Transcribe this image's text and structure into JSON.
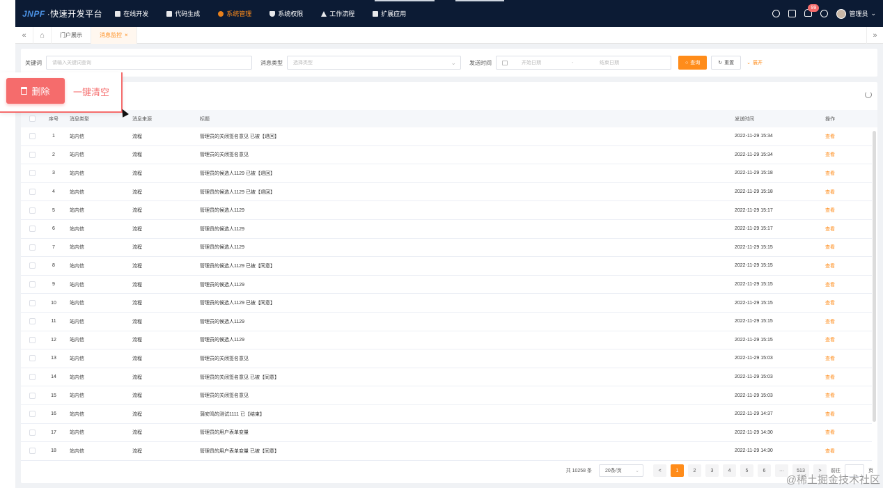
{
  "app": {
    "logo_brand": "JNPF",
    "logo_name": "·快速开发平台",
    "nav": [
      {
        "label": "在线开发",
        "icon": "monitor-icon",
        "active": false
      },
      {
        "label": "代码生成",
        "icon": "code-icon",
        "active": false
      },
      {
        "label": "系统管理",
        "icon": "gear-icon",
        "active": true
      },
      {
        "label": "系统权限",
        "icon": "shield-icon",
        "active": false
      },
      {
        "label": "工作流程",
        "icon": "workflow-icon",
        "active": false
      },
      {
        "label": "扩展应用",
        "icon": "apps-icon",
        "active": false
      }
    ],
    "notification_count": "99",
    "user_label": "管理员",
    "accent_color": "#ff8c1a",
    "danger_color": "#f56c6c"
  },
  "tabs": [
    {
      "label": "门户展示",
      "active": false
    },
    {
      "label": "消息监控",
      "active": true
    }
  ],
  "search": {
    "keyword_label": "关键词",
    "keyword_placeholder": "请输入关键词查询",
    "type_label": "消息类型",
    "type_placeholder": "选择类型",
    "time_label": "发送时间",
    "start_placeholder": "开始日期",
    "range_sep": "-",
    "end_placeholder": "结束日期",
    "query_label": "查询",
    "reset_label": "重置",
    "expand_label": "展开"
  },
  "callout": {
    "delete_label": "删除",
    "clear_label": "一键清空"
  },
  "table": {
    "headers": {
      "index": "序号",
      "type": "消息类型",
      "source": "消息来源",
      "title": "标题",
      "time": "发送时间",
      "action": "操作"
    },
    "rows": [
      {
        "index": "1",
        "type": "站内信",
        "source": "流程",
        "title": "管理员的关闭签名意见 已被【退回】",
        "time": "2022-11-29 15:34",
        "action": "查看"
      },
      {
        "index": "2",
        "type": "站内信",
        "source": "流程",
        "title": "管理员的关闭签名意见",
        "time": "2022-11-29 15:34",
        "action": "查看"
      },
      {
        "index": "3",
        "type": "站内信",
        "source": "流程",
        "title": "管理员的候选人1129 已被【退回】",
        "time": "2022-11-29 15:18",
        "action": "查看"
      },
      {
        "index": "4",
        "type": "站内信",
        "source": "流程",
        "title": "管理员的候选人1129 已被【退回】",
        "time": "2022-11-29 15:18",
        "action": "查看"
      },
      {
        "index": "5",
        "type": "站内信",
        "source": "流程",
        "title": "管理员的候选人1129",
        "time": "2022-11-29 15:17",
        "action": "查看"
      },
      {
        "index": "6",
        "type": "站内信",
        "source": "流程",
        "title": "管理员的候选人1129",
        "time": "2022-11-29 15:17",
        "action": "查看"
      },
      {
        "index": "7",
        "type": "站内信",
        "source": "流程",
        "title": "管理员的候选人1129",
        "time": "2022-11-29 15:15",
        "action": "查看"
      },
      {
        "index": "8",
        "type": "站内信",
        "source": "流程",
        "title": "管理员的候选人1129 已被【同意】",
        "time": "2022-11-29 15:15",
        "action": "查看"
      },
      {
        "index": "9",
        "type": "站内信",
        "source": "流程",
        "title": "管理员的候选人1129",
        "time": "2022-11-29 15:15",
        "action": "查看"
      },
      {
        "index": "10",
        "type": "站内信",
        "source": "流程",
        "title": "管理员的候选人1129 已被【同意】",
        "time": "2022-11-29 15:15",
        "action": "查看"
      },
      {
        "index": "11",
        "type": "站内信",
        "source": "流程",
        "title": "管理员的候选人1129",
        "time": "2022-11-29 15:15",
        "action": "查看"
      },
      {
        "index": "12",
        "type": "站内信",
        "source": "流程",
        "title": "管理员的候选人1129",
        "time": "2022-11-29 15:15",
        "action": "查看"
      },
      {
        "index": "13",
        "type": "站内信",
        "source": "流程",
        "title": "管理员的关闭签名意见",
        "time": "2022-11-29 15:03",
        "action": "查看"
      },
      {
        "index": "14",
        "type": "站内信",
        "source": "流程",
        "title": "管理员的关闭签名意见 已被【同意】",
        "time": "2022-11-29 15:03",
        "action": "查看"
      },
      {
        "index": "15",
        "type": "站内信",
        "source": "流程",
        "title": "管理员的关闭签名意见",
        "time": "2022-11-29 15:03",
        "action": "查看"
      },
      {
        "index": "16",
        "type": "站内信",
        "source": "流程",
        "title": "蒲安鸣的测试1111 已【结束】",
        "time": "2022-11-29 14:37",
        "action": "查看"
      },
      {
        "index": "17",
        "type": "站内信",
        "source": "流程",
        "title": "管理员的用户表单变量",
        "time": "2022-11-29 14:30",
        "action": "查看"
      },
      {
        "index": "18",
        "type": "站内信",
        "source": "流程",
        "title": "管理员的用户表单变量 已被【同意】",
        "time": "2022-11-29 14:30",
        "action": "查看"
      }
    ]
  },
  "pager": {
    "total_label": "共 10258 条",
    "page_size": "20条/页",
    "prev": "<",
    "pages": [
      "1",
      "2",
      "3",
      "4",
      "5",
      "6"
    ],
    "ellipsis": "···",
    "last_page": "513",
    "next": ">",
    "goto_label": "前往",
    "page_unit": "页"
  },
  "watermark": "@稀土掘金技术社区"
}
